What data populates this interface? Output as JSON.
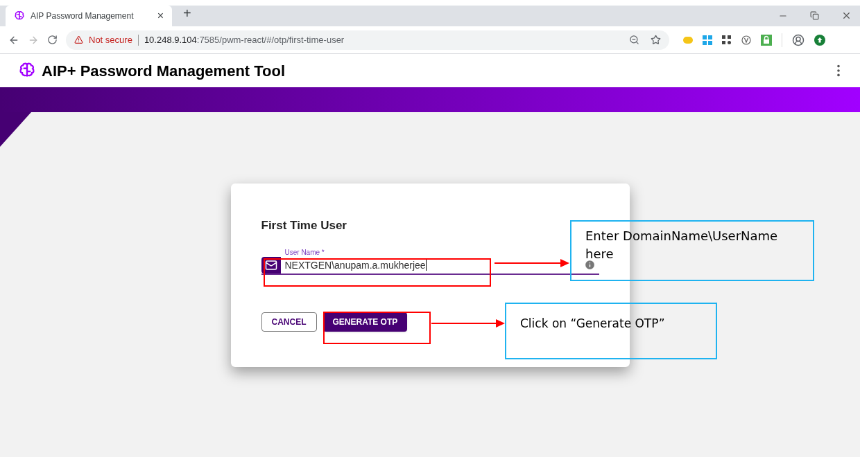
{
  "browser": {
    "tab": {
      "title": "AIP Password Management",
      "close": "×",
      "selected": true
    },
    "new_tab": "+",
    "security": "Not secure",
    "url": {
      "host": "10.248.9.104",
      "path": ":7585/pwm-react/#/otp/first-time-user"
    }
  },
  "app": {
    "title": "AIP+ Password Management Tool"
  },
  "dialog": {
    "title": "First Time User",
    "field": {
      "label": "User Name *",
      "value": "NEXTGEN\\anupam.a.mukherjee",
      "focused": true
    },
    "buttons": [
      {
        "label": "CANCEL",
        "kind": "outlined"
      },
      {
        "label": "GENERATE OTP",
        "kind": "filled"
      }
    ]
  },
  "callouts": [
    {
      "text": "Enter DomainName\\UserName here"
    },
    {
      "text": "Click on “Generate OTP”"
    }
  ]
}
